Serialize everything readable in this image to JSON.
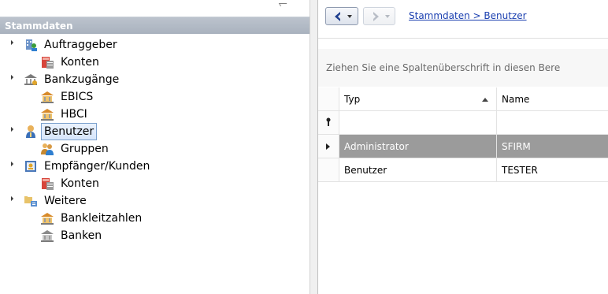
{
  "tree": {
    "header": "Stammdaten",
    "nodes": [
      {
        "label": "Auftraggeber",
        "icon": "building-users-icon",
        "expanded": true
      },
      {
        "label": "Konten",
        "icon": "account-book-icon"
      },
      {
        "label": "Bankzugänge",
        "icon": "bank-icon",
        "expanded": true
      },
      {
        "label": "EBICS",
        "icon": "bank-house-icon"
      },
      {
        "label": "HBCI",
        "icon": "bank-house-icon"
      },
      {
        "label": "Benutzer",
        "icon": "user-icon",
        "expanded": true,
        "selected": true
      },
      {
        "label": "Gruppen",
        "icon": "users-group-icon"
      },
      {
        "label": "Empfänger/Kunden",
        "icon": "contacts-icon",
        "expanded": true
      },
      {
        "label": "Konten",
        "icon": "account-book-icon"
      },
      {
        "label": "Weitere",
        "icon": "folder-tree-icon",
        "expanded": true
      },
      {
        "label": "Bankleitzahlen",
        "icon": "bank-house-icon"
      },
      {
        "label": "Banken",
        "icon": "bank-house-icon"
      }
    ]
  },
  "nav": {
    "breadcrumb": "Stammdaten > Benutzer"
  },
  "grid": {
    "group_hint": "Ziehen Sie eine Spaltenüberschrift in diesen Bere",
    "columns": [
      "Typ",
      "Name"
    ],
    "rows": [
      {
        "typ": "Administrator",
        "name": "SFIRM",
        "selected": true
      },
      {
        "typ": "Benutzer",
        "name": "TESTER"
      }
    ]
  },
  "colors": {
    "header_bg": "#b2bac6",
    "selection_bg": "#9b9b9b",
    "link": "#1a3fb0"
  }
}
